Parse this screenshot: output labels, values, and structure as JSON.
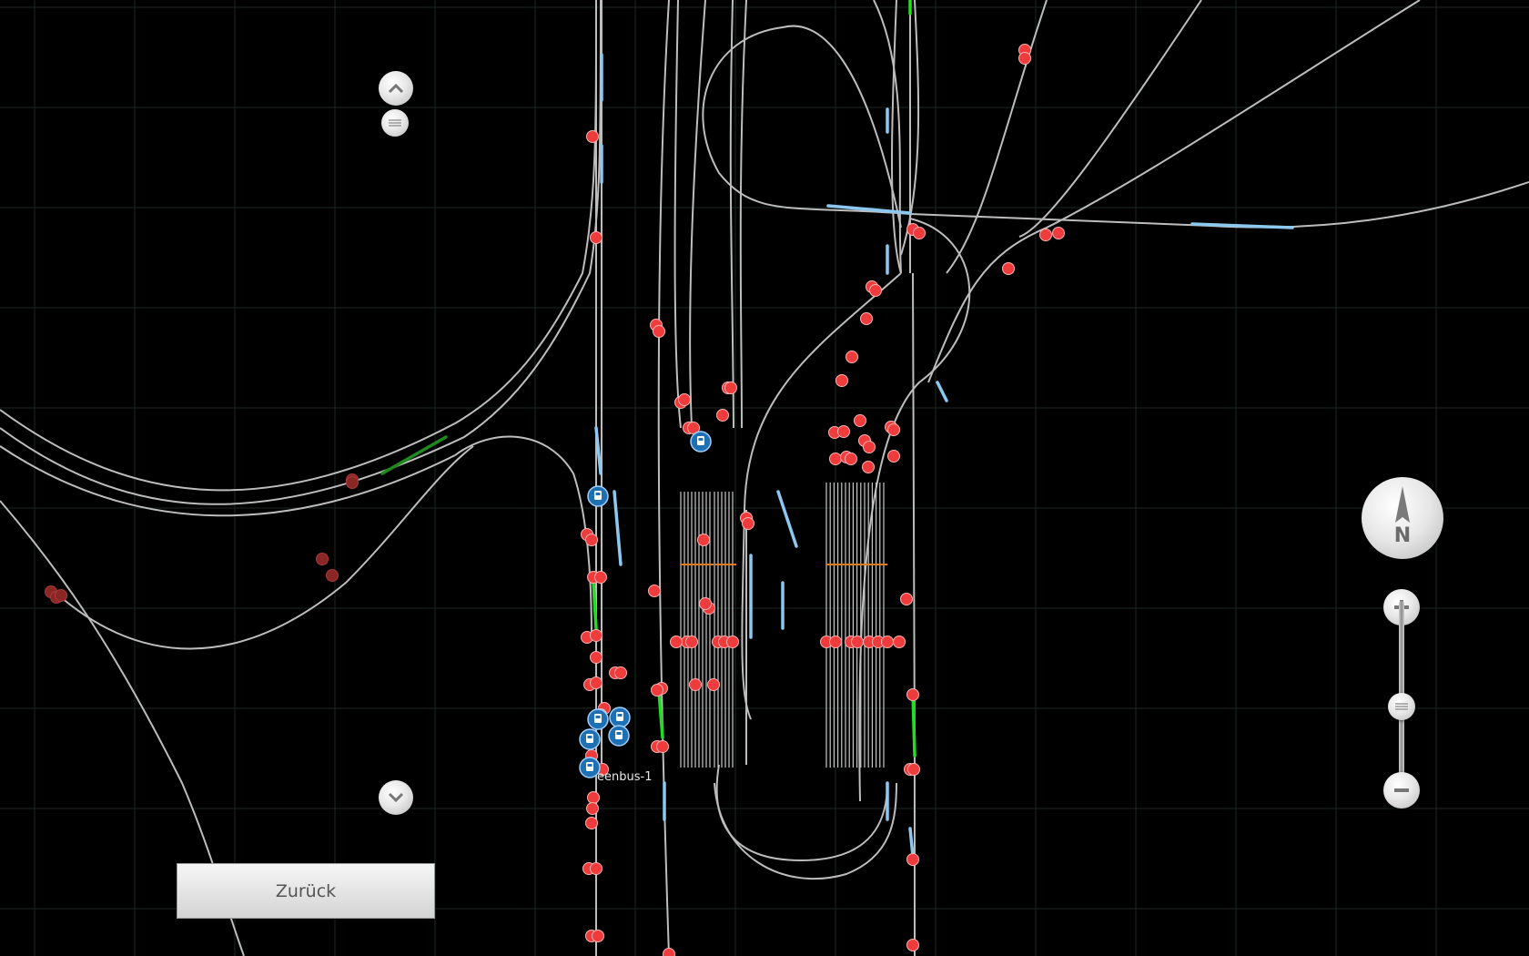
{
  "navigation": {
    "back_label": "Zurück"
  },
  "compass": {
    "north_label": "N"
  },
  "map": {
    "vehicle_label": "eenbus-1",
    "zoom_level": 0.55,
    "icons": {
      "scroll_up": "chevron-up-icon",
      "scroll_down": "chevron-down-icon",
      "zoom_in": "plus-icon",
      "zoom_out": "minus-icon",
      "stop": "red-stop-marker-icon",
      "bus": "bus-marker-icon"
    },
    "colors": {
      "background": "#000000",
      "grid": "#1e2a24",
      "track": "#bfbfbf",
      "highlight": "#8cc8f0",
      "active": "#22dd22",
      "stop": "#ee3b3b",
      "bus": "#1f6fb3"
    }
  }
}
